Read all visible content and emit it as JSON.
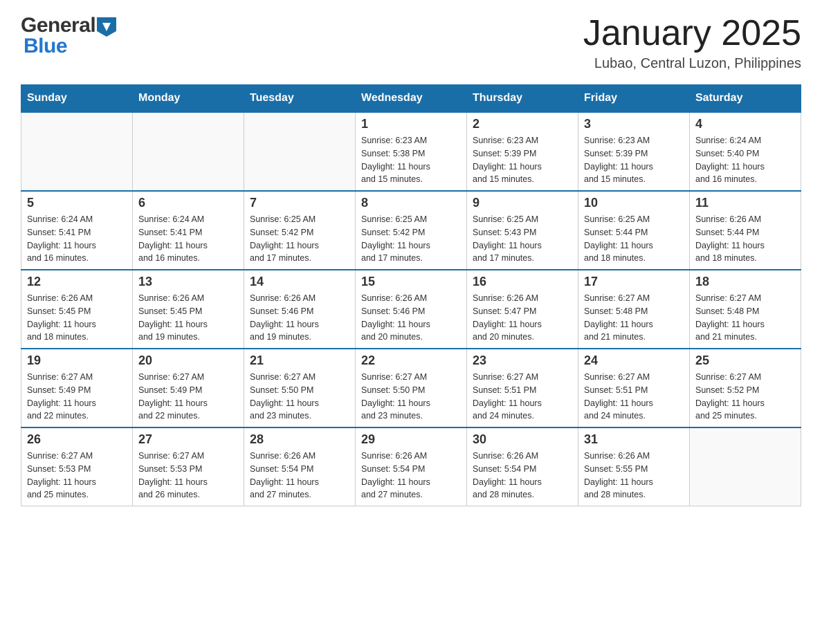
{
  "logo": {
    "general_text": "General",
    "blue_text": "Blue"
  },
  "title": "January 2025",
  "location": "Lubao, Central Luzon, Philippines",
  "days_of_week": [
    "Sunday",
    "Monday",
    "Tuesday",
    "Wednesday",
    "Thursday",
    "Friday",
    "Saturday"
  ],
  "weeks": [
    {
      "days": [
        {
          "date": "",
          "info": ""
        },
        {
          "date": "",
          "info": ""
        },
        {
          "date": "",
          "info": ""
        },
        {
          "date": "1",
          "info": "Sunrise: 6:23 AM\nSunset: 5:38 PM\nDaylight: 11 hours\nand 15 minutes."
        },
        {
          "date": "2",
          "info": "Sunrise: 6:23 AM\nSunset: 5:39 PM\nDaylight: 11 hours\nand 15 minutes."
        },
        {
          "date": "3",
          "info": "Sunrise: 6:23 AM\nSunset: 5:39 PM\nDaylight: 11 hours\nand 15 minutes."
        },
        {
          "date": "4",
          "info": "Sunrise: 6:24 AM\nSunset: 5:40 PM\nDaylight: 11 hours\nand 16 minutes."
        }
      ]
    },
    {
      "days": [
        {
          "date": "5",
          "info": "Sunrise: 6:24 AM\nSunset: 5:41 PM\nDaylight: 11 hours\nand 16 minutes."
        },
        {
          "date": "6",
          "info": "Sunrise: 6:24 AM\nSunset: 5:41 PM\nDaylight: 11 hours\nand 16 minutes."
        },
        {
          "date": "7",
          "info": "Sunrise: 6:25 AM\nSunset: 5:42 PM\nDaylight: 11 hours\nand 17 minutes."
        },
        {
          "date": "8",
          "info": "Sunrise: 6:25 AM\nSunset: 5:42 PM\nDaylight: 11 hours\nand 17 minutes."
        },
        {
          "date": "9",
          "info": "Sunrise: 6:25 AM\nSunset: 5:43 PM\nDaylight: 11 hours\nand 17 minutes."
        },
        {
          "date": "10",
          "info": "Sunrise: 6:25 AM\nSunset: 5:44 PM\nDaylight: 11 hours\nand 18 minutes."
        },
        {
          "date": "11",
          "info": "Sunrise: 6:26 AM\nSunset: 5:44 PM\nDaylight: 11 hours\nand 18 minutes."
        }
      ]
    },
    {
      "days": [
        {
          "date": "12",
          "info": "Sunrise: 6:26 AM\nSunset: 5:45 PM\nDaylight: 11 hours\nand 18 minutes."
        },
        {
          "date": "13",
          "info": "Sunrise: 6:26 AM\nSunset: 5:45 PM\nDaylight: 11 hours\nand 19 minutes."
        },
        {
          "date": "14",
          "info": "Sunrise: 6:26 AM\nSunset: 5:46 PM\nDaylight: 11 hours\nand 19 minutes."
        },
        {
          "date": "15",
          "info": "Sunrise: 6:26 AM\nSunset: 5:46 PM\nDaylight: 11 hours\nand 20 minutes."
        },
        {
          "date": "16",
          "info": "Sunrise: 6:26 AM\nSunset: 5:47 PM\nDaylight: 11 hours\nand 20 minutes."
        },
        {
          "date": "17",
          "info": "Sunrise: 6:27 AM\nSunset: 5:48 PM\nDaylight: 11 hours\nand 21 minutes."
        },
        {
          "date": "18",
          "info": "Sunrise: 6:27 AM\nSunset: 5:48 PM\nDaylight: 11 hours\nand 21 minutes."
        }
      ]
    },
    {
      "days": [
        {
          "date": "19",
          "info": "Sunrise: 6:27 AM\nSunset: 5:49 PM\nDaylight: 11 hours\nand 22 minutes."
        },
        {
          "date": "20",
          "info": "Sunrise: 6:27 AM\nSunset: 5:49 PM\nDaylight: 11 hours\nand 22 minutes."
        },
        {
          "date": "21",
          "info": "Sunrise: 6:27 AM\nSunset: 5:50 PM\nDaylight: 11 hours\nand 23 minutes."
        },
        {
          "date": "22",
          "info": "Sunrise: 6:27 AM\nSunset: 5:50 PM\nDaylight: 11 hours\nand 23 minutes."
        },
        {
          "date": "23",
          "info": "Sunrise: 6:27 AM\nSunset: 5:51 PM\nDaylight: 11 hours\nand 24 minutes."
        },
        {
          "date": "24",
          "info": "Sunrise: 6:27 AM\nSunset: 5:51 PM\nDaylight: 11 hours\nand 24 minutes."
        },
        {
          "date": "25",
          "info": "Sunrise: 6:27 AM\nSunset: 5:52 PM\nDaylight: 11 hours\nand 25 minutes."
        }
      ]
    },
    {
      "days": [
        {
          "date": "26",
          "info": "Sunrise: 6:27 AM\nSunset: 5:53 PM\nDaylight: 11 hours\nand 25 minutes."
        },
        {
          "date": "27",
          "info": "Sunrise: 6:27 AM\nSunset: 5:53 PM\nDaylight: 11 hours\nand 26 minutes."
        },
        {
          "date": "28",
          "info": "Sunrise: 6:26 AM\nSunset: 5:54 PM\nDaylight: 11 hours\nand 27 minutes."
        },
        {
          "date": "29",
          "info": "Sunrise: 6:26 AM\nSunset: 5:54 PM\nDaylight: 11 hours\nand 27 minutes."
        },
        {
          "date": "30",
          "info": "Sunrise: 6:26 AM\nSunset: 5:54 PM\nDaylight: 11 hours\nand 28 minutes."
        },
        {
          "date": "31",
          "info": "Sunrise: 6:26 AM\nSunset: 5:55 PM\nDaylight: 11 hours\nand 28 minutes."
        },
        {
          "date": "",
          "info": ""
        }
      ]
    }
  ]
}
